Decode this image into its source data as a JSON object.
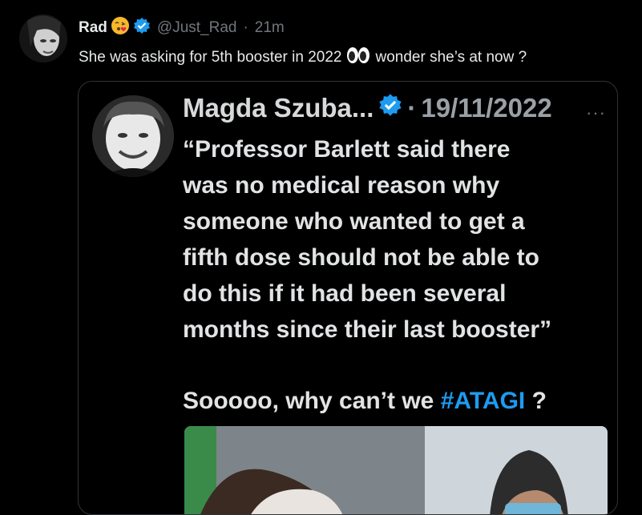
{
  "author": {
    "name": "Rad",
    "handle": "@Just_Rad",
    "time": "21m",
    "verified": true
  },
  "tweet": {
    "text_part1": "She was asking for 5th booster in 2022",
    "text_part2": "wonder she’s at now ?"
  },
  "quoted": {
    "author_name": "Magda Szuba...",
    "date": "19/11/2022",
    "verified": true,
    "more_label": "···",
    "body_lines": [
      "“Professor Barlett said there",
      "was no medical reason why",
      "someone who wanted to get a",
      "fifth dose should not be able to",
      "do this if it had been several",
      "months since their last booster”"
    ],
    "question_prefix": "Sooooo, why can’t we ",
    "hashtag": "#ATAGI",
    "question_suffix": " ?"
  },
  "colors": {
    "background": "#000000",
    "text": "#e7e9ea",
    "muted": "#71767b",
    "verified_blue": "#1d9bf0",
    "hashtag": "#1d9bf0"
  },
  "icons": [
    "avatar",
    "kiss-emoji-icon",
    "verified-badge-icon",
    "eyes-emoji-icon",
    "more-options-icon"
  ]
}
